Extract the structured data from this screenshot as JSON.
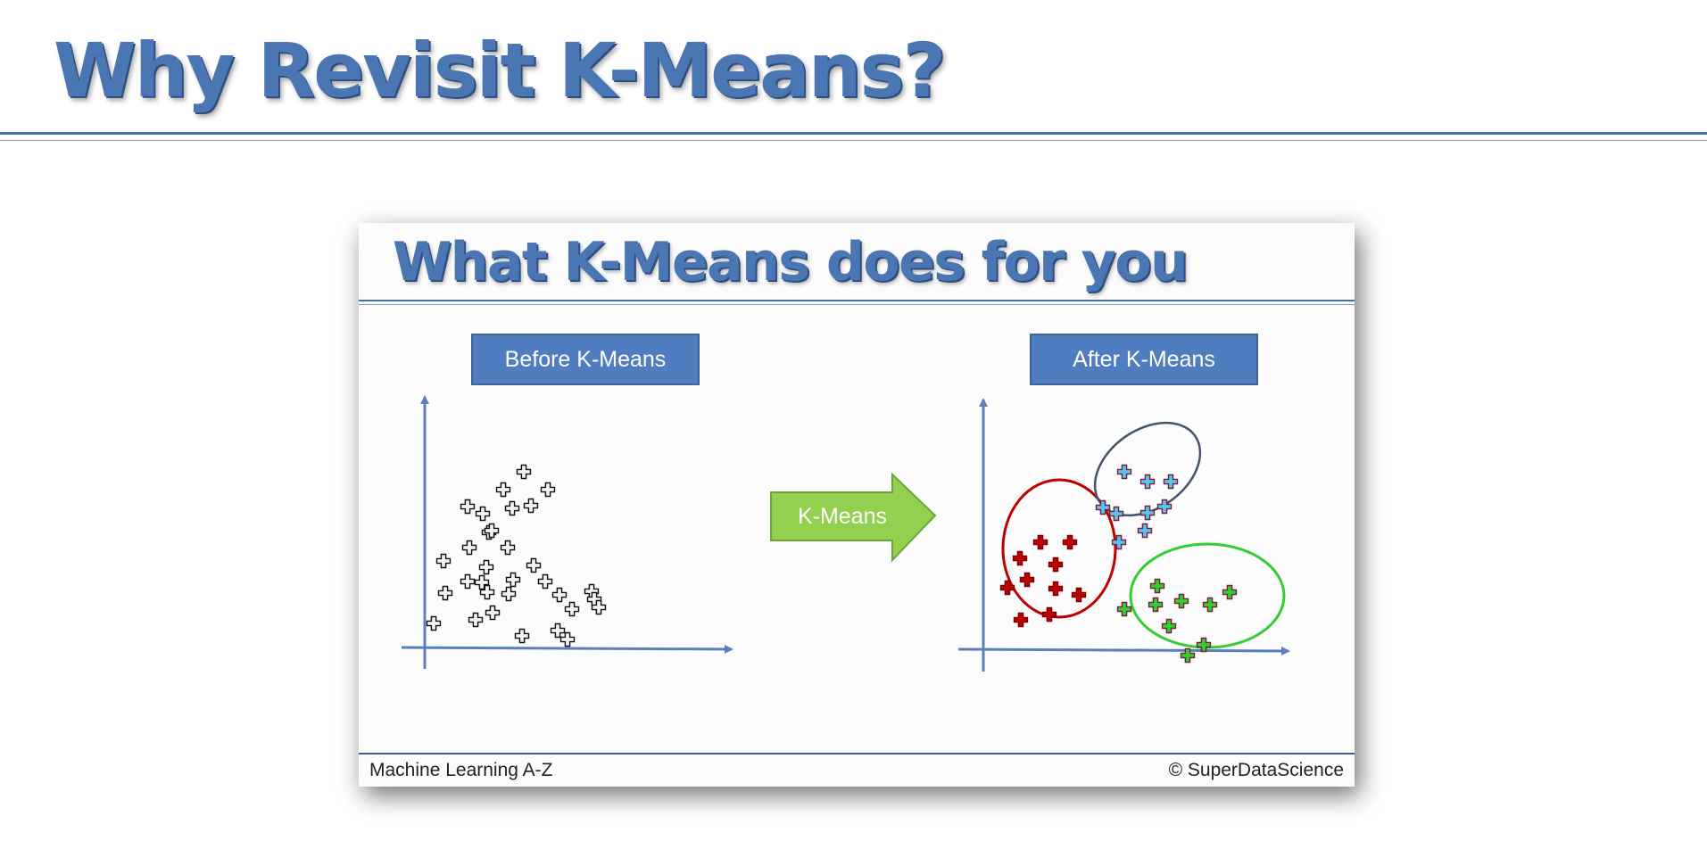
{
  "page": {
    "title": "Why Revisit K-Means?"
  },
  "slide": {
    "title": "What K-Means does for you",
    "before_label": "Before K-Means",
    "after_label": "After K-Means",
    "arrow_label": "K-Means",
    "footer_left": "Machine Learning A-Z",
    "footer_right": "© SuperDataScience"
  },
  "colors": {
    "title_blue": "#4a77b4",
    "axis_blue": "#5b7fbd",
    "label_box": "#4f7dbf",
    "arrow_green": "#92d050",
    "cluster_red": "#c00000",
    "cluster_blue": "#44546a",
    "cluster_green": "#33cc33",
    "plus_blue": "#5bc0eb",
    "plus_green": "#33cc33",
    "plus_gray": "#f2f2f2"
  }
}
